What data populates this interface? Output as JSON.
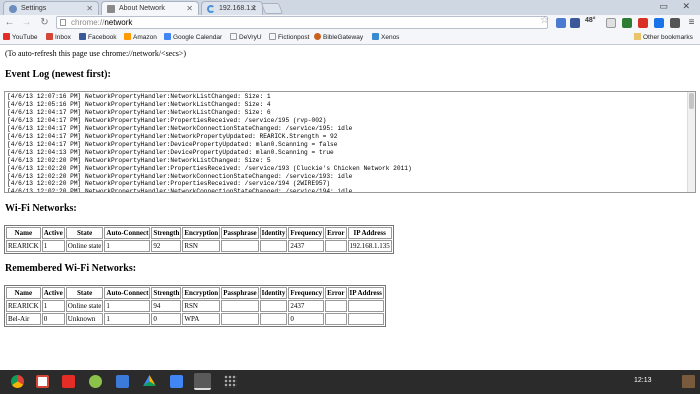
{
  "browser": {
    "tabs": [
      {
        "title": "Settings",
        "icon": "gear-icon",
        "color": "#6c8ebf",
        "active": false
      },
      {
        "title": "About Network",
        "icon": "page-icon",
        "color": "#8a8a8a",
        "active": true
      },
      {
        "title": "192.168.1.1",
        "icon": "loading-icon",
        "color": "#4a90d9",
        "active": false
      }
    ],
    "close_glyph": "✕",
    "window_controls": "▭ ✕",
    "back_glyph": "←",
    "forward_glyph": "→",
    "reload_glyph": "↻",
    "url_scheme": "chrome://",
    "url_host": "network",
    "star_glyph": "☆",
    "weather_temp": "48°",
    "menu_glyph": "≡"
  },
  "bookmarks": {
    "items": [
      {
        "label": "YouTube",
        "color": "#e52d27"
      },
      {
        "label": "Inbox",
        "color": "#d44638"
      },
      {
        "label": "Facebook",
        "color": "#3b5998"
      },
      {
        "label": "Amazon",
        "color": "#ff9900"
      },
      {
        "label": "Google Calendar",
        "color": "#4285f4"
      },
      {
        "label": "DeVryU",
        "color": "#cccccc"
      },
      {
        "label": "Fictionpost",
        "color": "#cccccc"
      },
      {
        "label": "BibleGateway",
        "color": "#c8601e"
      },
      {
        "label": "Xenos",
        "color": "#3a8ad0"
      }
    ],
    "other": "Other bookmarks"
  },
  "page": {
    "autorefresh_note": "(To auto-refresh this page use chrome://network/<secs>)",
    "event_log_heading": "Event Log (newest first):",
    "event_log_lines": [
      "[4/6/13 12:07:16 PM] NetworkPropertyHandler:NetworkListChanged: Size: 1",
      "[4/6/13 12:05:16 PM] NetworkPropertyHandler:NetworkListChanged: Size: 4",
      "[4/6/13 12:04:17 PM] NetworkPropertyHandler:NetworkListChanged: Size: 6",
      "[4/6/13 12:04:17 PM] NetworkPropertyHandler:PropertiesReceived: /service/195 (rvp-002)",
      "[4/6/13 12:04:17 PM] NetworkPropertyHandler:NetworkConnectionStateChanged: /service/195: idle",
      "[4/6/13 12:04:17 PM] NetworkPropertyHandler:NetworkPropertyUpdated: REARICK.Strength = 92",
      "[4/6/13 12:04:17 PM] NetworkPropertyHandler:DevicePropertyUpdated: mlan0.Scanning = false",
      "[4/6/13 12:04:13 PM] NetworkPropertyHandler:DevicePropertyUpdated: mlan0.Scanning = true",
      "[4/6/13 12:02:20 PM] NetworkPropertyHandler:NetworkListChanged: Size: 5",
      "[4/6/13 12:02:20 PM] NetworkPropertyHandler:PropertiesReceived: /service/193 (Cluckie's Chicken Network 2011)",
      "[4/6/13 12:02:20 PM] NetworkPropertyHandler:NetworkConnectionStateChanged: /service/193: idle",
      "[4/6/13 12:02:20 PM] NetworkPropertyHandler:PropertiesReceived: /service/194 (2WIRE957)",
      "[4/6/13 12:02:20 PM] NetworkPropertyHandler:NetworkConnectionStateChanged: /service/194: idle"
    ],
    "wifi_heading": "Wi-Fi Networks:",
    "remembered_heading": "Remembered Wi-Fi Networks:",
    "columns": [
      "Name",
      "Active",
      "State",
      "Auto-Connect",
      "Strength",
      "Encryption",
      "Passphrase",
      "Identity",
      "Frequency",
      "Error",
      "IP Address"
    ],
    "wifi_rows": [
      [
        "REARICK",
        "1",
        "Online state",
        "1",
        "92",
        "RSN",
        "",
        "",
        "2437",
        "",
        "192.168.1.135"
      ]
    ],
    "remembered_rows": [
      [
        "REARICK",
        "1",
        "Online state",
        "1",
        "94",
        "RSN",
        "",
        "",
        "2437",
        "",
        ""
      ],
      [
        "Bel-Air",
        "0",
        "Unknown",
        "1",
        "0",
        "WPA",
        "",
        "",
        "0",
        "",
        ""
      ]
    ]
  },
  "shelf": {
    "apps": [
      {
        "name": "chrome-icon",
        "color": "#dd4b39"
      },
      {
        "name": "gmail-icon",
        "color": "#d44638"
      },
      {
        "name": "youtube-icon",
        "color": "#e52d27"
      },
      {
        "name": "android-icon",
        "color": "#8bc34a"
      },
      {
        "name": "app-store-icon",
        "color": "#3b7ad9"
      },
      {
        "name": "drive-icon",
        "color": "#f4b400"
      },
      {
        "name": "files-icon",
        "color": "#4285f4"
      },
      {
        "name": "active-window-icon",
        "color": "#c8c8c8"
      },
      {
        "name": "app-launcher-icon",
        "color": "#9e9e9e"
      }
    ],
    "clock": "12:13"
  }
}
